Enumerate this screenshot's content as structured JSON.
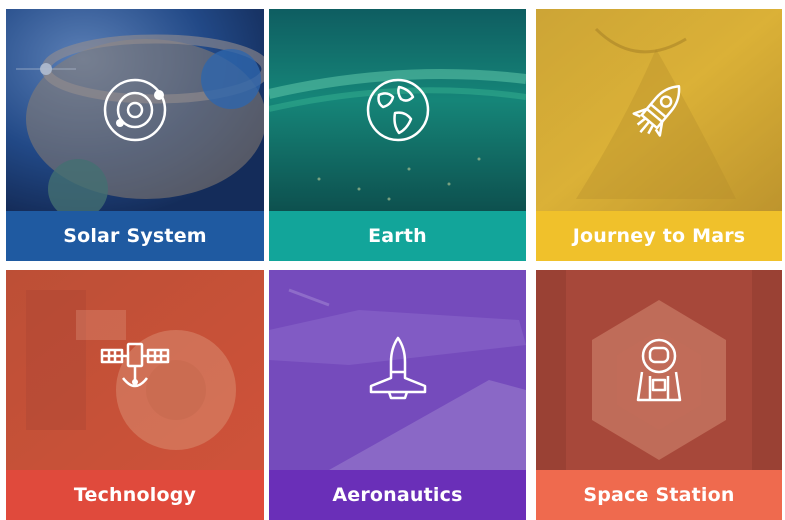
{
  "tiles": [
    {
      "id": "solar-system",
      "label": "Solar System",
      "icon": "solar-system-icon",
      "color": "#1f5aa1",
      "tint": "#1b3f78"
    },
    {
      "id": "earth",
      "label": "Earth",
      "icon": "earth-globe-icon",
      "color": "#12a59a",
      "tint": "#0d7b72"
    },
    {
      "id": "journey-to-mars",
      "label": "Journey to Mars",
      "icon": "rocket-icon",
      "color": "#f0c12b",
      "tint": "#d9a92a"
    },
    {
      "id": "technology",
      "label": "Technology",
      "icon": "satellite-icon",
      "color": "#e04a3c",
      "tint": "#c8472f"
    },
    {
      "id": "aeronautics",
      "label": "Aeronautics",
      "icon": "shuttle-icon",
      "color": "#6a2fb8",
      "tint": "#6e3fb0"
    },
    {
      "id": "space-station",
      "label": "Space Station",
      "icon": "astronaut-icon",
      "color": "#ef6a4e",
      "tint": "#b8513c"
    }
  ]
}
